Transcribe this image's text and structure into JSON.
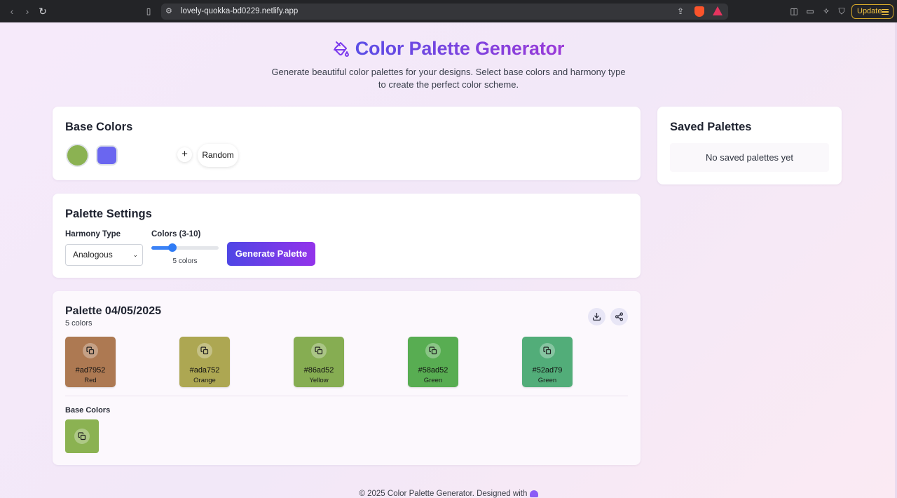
{
  "browser": {
    "url": "lovely-quokka-bd0229.netlify.app",
    "update_label": "Update"
  },
  "header": {
    "title": "Color Palette Generator",
    "subtitle": "Generate beautiful color palettes for your designs. Select base colors and harmony type to create the perfect color scheme."
  },
  "base_colors": {
    "title": "Base Colors",
    "swatches": [
      "#8bb252",
      "#6a66f0"
    ],
    "add_label": "+",
    "random_label": "Random"
  },
  "settings": {
    "title": "Palette Settings",
    "harmony_label": "Harmony Type",
    "harmony_value": "Analogous",
    "colors_label": "Colors (3-10)",
    "colors_value": 5,
    "colors_min": 3,
    "colors_max": 10,
    "colors_caption": "5 colors",
    "generate_label": "Generate Palette"
  },
  "palette": {
    "title": "Palette 04/05/2025",
    "subtitle": "5 colors",
    "colors": [
      {
        "hex": "#ad7952",
        "name": "Red"
      },
      {
        "hex": "#ada752",
        "name": "Orange"
      },
      {
        "hex": "#86ad52",
        "name": "Yellow"
      },
      {
        "hex": "#58ad52",
        "name": "Green"
      },
      {
        "hex": "#52ad79",
        "name": "Green"
      }
    ],
    "base_label": "Base Colors",
    "base_swatch": "#8bb252"
  },
  "saved": {
    "title": "Saved Palettes",
    "empty_text": "No saved palettes yet"
  },
  "footer": {
    "text": "© 2025 Color Palette Generator. Designed with"
  },
  "accent": "#7c3aed"
}
